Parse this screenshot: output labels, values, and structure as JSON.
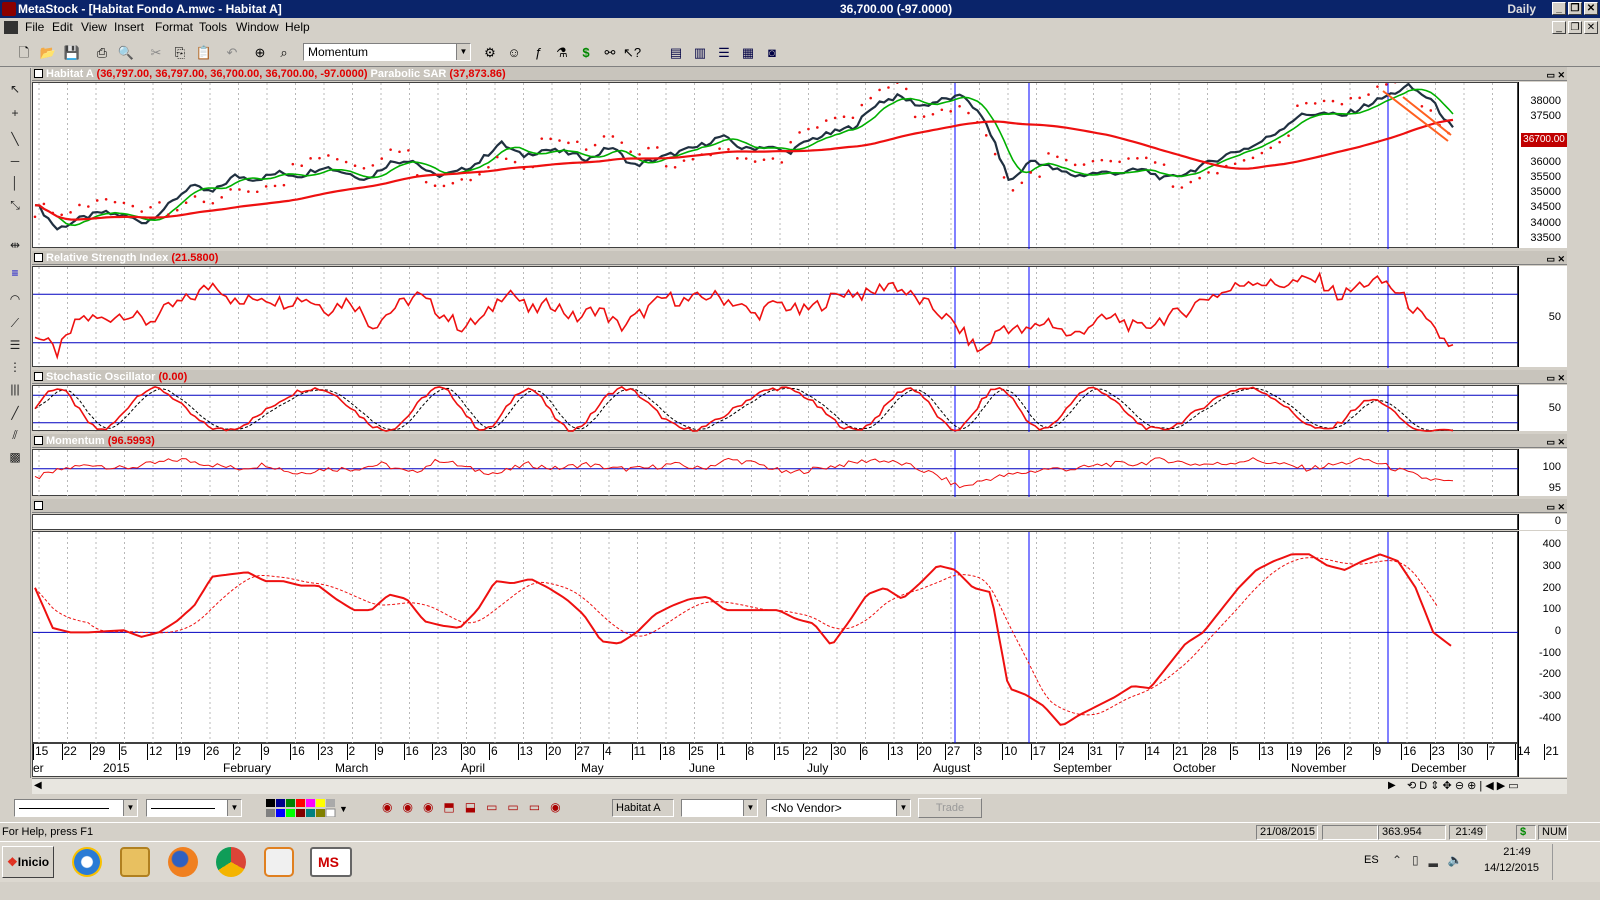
{
  "title_bar": {
    "app_title": "MetaStock - [Habitat Fondo A.mwc - Habitat A]",
    "quote": "36,700.00 (-97.0000)",
    "periodicity": "Daily"
  },
  "menu": [
    "File",
    "Edit",
    "View",
    "Insert",
    "Format",
    "Tools",
    "Window",
    "Help"
  ],
  "toolbar": {
    "indicator_select": "Momentum"
  },
  "panes": {
    "price": {
      "name": "Habitat A",
      "values": "(36,797.00, 36,797.00, 36,700.00, 36,700.00, -97.0000)",
      "overlay_name": "Parabolic SAR",
      "overlay_value": "(37,873.86)",
      "last_price_tag": "36700.00",
      "yticks": [
        "38000",
        "37500",
        "37000",
        "36500",
        "36000",
        "35500",
        "35000",
        "34500",
        "34000",
        "33500"
      ]
    },
    "rsi": {
      "name": "Relative Strength Index",
      "value": "(21.5800)",
      "yticks": [
        "50"
      ]
    },
    "stoch": {
      "name": "Stochastic Oscillator",
      "value": "(0.00)",
      "yticks": [
        "50"
      ]
    },
    "momentum": {
      "name": "Momentum",
      "value": "(96.5993)",
      "yticks": [
        "100",
        "95"
      ]
    },
    "blank": {
      "yticks": [
        "0"
      ]
    },
    "macd": {
      "yticks": [
        "400",
        "300",
        "200",
        "100",
        "0",
        "-100",
        "-200",
        "-300",
        "-400"
      ]
    }
  },
  "x_axis": {
    "days": [
      "15",
      "22",
      "29",
      "5",
      "12",
      "19",
      "26",
      "2",
      "9",
      "16",
      "23",
      "2",
      "9",
      "16",
      "23",
      "30",
      "6",
      "13",
      "20",
      "27",
      "4",
      "11",
      "18",
      "25",
      "1",
      "8",
      "15",
      "22",
      "30",
      "6",
      "13",
      "20",
      "27",
      "3",
      "10",
      "17",
      "24",
      "31",
      "7",
      "14",
      "21",
      "28",
      "5",
      "13",
      "19",
      "26",
      "2",
      "9",
      "16",
      "23",
      "30",
      "7",
      "14",
      "21"
    ],
    "months": [
      "er",
      "2015",
      "February",
      "March",
      "April",
      "May",
      "June",
      "July",
      "August",
      "September",
      "October",
      "November",
      "December"
    ]
  },
  "bottom_toolbar": {
    "security": "Habitat A",
    "vendor": "<No Vendor>",
    "trade": "Trade"
  },
  "status_bar": {
    "help": "For Help, press F1",
    "date": "21/08/2015",
    "value": "363.954",
    "time": "21:49",
    "currency": "$",
    "num": "NUM"
  },
  "taskbar": {
    "start": "Inicio",
    "lang": "ES",
    "clock_time": "21:49",
    "clock_date": "14/12/2015"
  },
  "chart_data": [
    {
      "type": "line",
      "title": "Habitat A",
      "series": [
        {
          "name": "Parabolic SAR",
          "values": []
        }
      ],
      "ylim": [
        33300,
        38300
      ]
    },
    {
      "type": "line",
      "title": "Relative Strength Index",
      "ylim": [
        0,
        100
      ]
    },
    {
      "type": "line",
      "title": "Stochastic Oscillator",
      "ylim": [
        0,
        100
      ]
    },
    {
      "type": "line",
      "title": "Momentum",
      "ylim": [
        94,
        104
      ]
    },
    {
      "type": "line",
      "ylim": [
        -500,
        450
      ],
      "series": [
        {
          "values": [
            200,
            20,
            0,
            0,
            5,
            10,
            -20,
            0,
            50,
            120,
            250,
            260,
            270,
            230,
            230,
            210,
            210,
            150,
            100,
            100,
            170,
            150,
            50,
            30,
            20,
            100,
            230,
            220,
            240,
            200,
            150,
            80,
            -40,
            -50,
            0,
            80,
            120,
            150,
            160,
            100,
            100,
            100,
            100,
            60,
            40,
            -60,
            50,
            170,
            200,
            150,
            220,
            300,
            280,
            200,
            180,
            -250,
            -280,
            -330,
            -420,
            -370,
            -330,
            -290,
            -240,
            -250,
            -150,
            -50,
            0,
            100,
            200,
            280,
            320,
            350,
            350,
            300,
            280,
            320,
            350,
            320,
            200,
            0,
            -60
          ]
        }
      ]
    }
  ]
}
